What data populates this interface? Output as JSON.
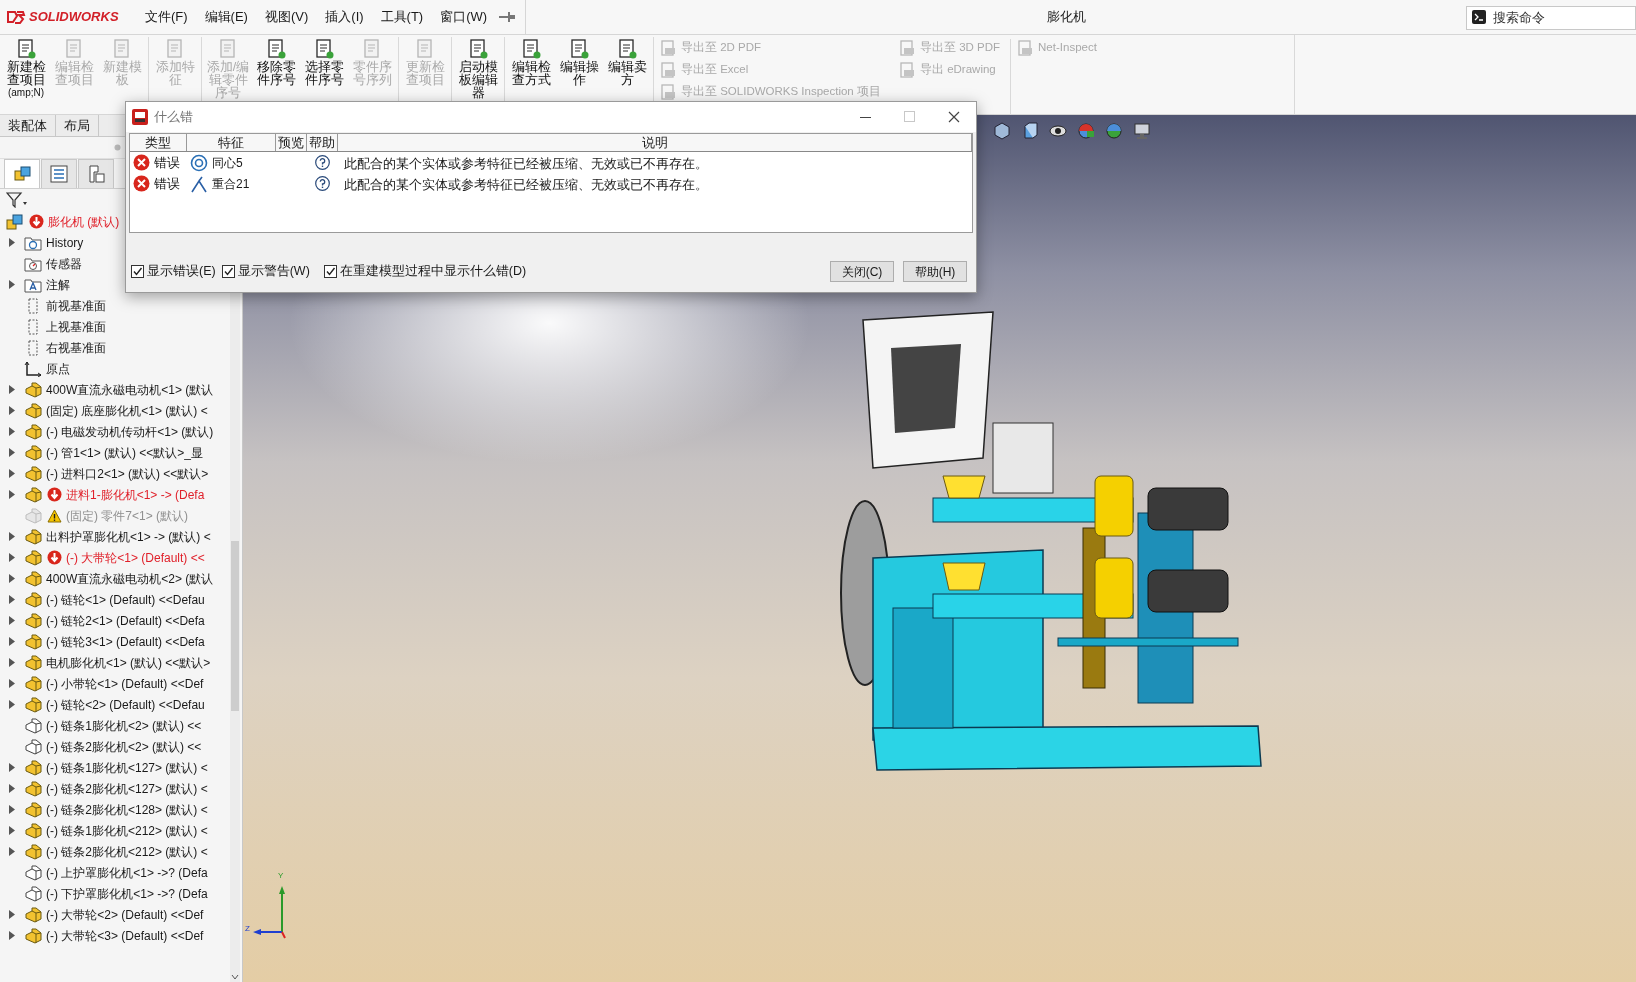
{
  "app": {
    "logo": "SOLIDWORKS",
    "menus": [
      "文件(F)",
      "编辑(E)",
      "视图(V)",
      "插入(I)",
      "工具(T)",
      "窗口(W)"
    ],
    "document_title": "膨化机",
    "search": {
      "placeholder": "搜索命令"
    }
  },
  "ribbon": {
    "buttons": [
      {
        "label": "新建检查项目",
        "shortcut": "(amp;N)",
        "enabled": true,
        "separator_before": false
      },
      {
        "label": "编辑检查项目",
        "enabled": false,
        "separator_before": false
      },
      {
        "label": "新建模板",
        "enabled": false,
        "separator_before": false
      },
      {
        "label": "添加特征",
        "enabled": false,
        "separator_before": true
      },
      {
        "label": "添加/编辑零件序号",
        "enabled": false,
        "separator_before": true
      },
      {
        "label": "移除零件序号",
        "enabled": true,
        "separator_before": false
      },
      {
        "label": "选择零件序号",
        "enabled": true,
        "separator_before": false
      },
      {
        "label": "零件序号序列",
        "enabled": false,
        "separator_before": false
      },
      {
        "label": "更新检查项目",
        "enabled": false,
        "separator_before": true
      },
      {
        "label": "启动模板编辑器",
        "enabled": true,
        "separator_before": true
      },
      {
        "label": "编辑检查方式",
        "enabled": true,
        "separator_before": true
      },
      {
        "label": "编辑操作",
        "enabled": true,
        "separator_before": false
      },
      {
        "label": "编辑卖方",
        "enabled": true,
        "separator_before": false
      }
    ],
    "export_columns": [
      [
        {
          "label": "导出至 2D PDF",
          "enabled": false
        },
        {
          "label": "导出至 Excel",
          "enabled": false
        },
        {
          "label": "导出至 SOLIDWORKS Inspection 项目",
          "enabled": false
        }
      ],
      [
        {
          "label": "导出至 3D PDF",
          "enabled": false
        },
        {
          "label": "导出 eDrawing",
          "enabled": false
        }
      ],
      [
        {
          "label": "Net-Inspect",
          "enabled": false
        }
      ]
    ]
  },
  "command_tabs": [
    {
      "label": "装配体"
    },
    {
      "label": "布局"
    }
  ],
  "panel_tabs": [
    {
      "kind": "tree",
      "selected": true
    },
    {
      "kind": "properties",
      "selected": false
    },
    {
      "kind": "configurations",
      "selected": false
    }
  ],
  "feature_tree": [
    {
      "label": "膨化机 (默认)",
      "kind": "assembly",
      "error": true,
      "warning": false,
      "suppressed": false,
      "expandable": false,
      "children": [
        {
          "label": "History",
          "kind": "history",
          "error": false,
          "warning": false,
          "suppressed": false,
          "expandable": true
        },
        {
          "label": "传感器",
          "kind": "sensors",
          "error": false,
          "warning": false,
          "suppressed": false,
          "expandable": false
        },
        {
          "label": "注解",
          "kind": "annotations",
          "error": false,
          "warning": false,
          "suppressed": false,
          "expandable": true
        },
        {
          "label": "前视基准面",
          "kind": "plane",
          "error": false,
          "warning": false,
          "suppressed": false,
          "expandable": false
        },
        {
          "label": "上视基准面",
          "kind": "plane",
          "error": false,
          "warning": false,
          "suppressed": false,
          "expandable": false
        },
        {
          "label": "右视基准面",
          "kind": "plane",
          "error": false,
          "warning": false,
          "suppressed": false,
          "expandable": false
        },
        {
          "label": "原点",
          "kind": "origin",
          "error": false,
          "warning": false,
          "suppressed": false,
          "expandable": false
        },
        {
          "label": "400W直流永磁电动机<1> (默认",
          "kind": "part",
          "error": false,
          "warning": false,
          "suppressed": false,
          "shown": true,
          "expandable": true
        },
        {
          "label": "(固定) 底座膨化机<1> (默认) <",
          "kind": "part",
          "error": false,
          "warning": false,
          "suppressed": false,
          "shown": true,
          "expandable": true
        },
        {
          "label": "(-) 电磁发动机传动杆<1> (默认)",
          "kind": "part",
          "error": false,
          "warning": false,
          "suppressed": false,
          "shown": true,
          "expandable": true
        },
        {
          "label": "(-) 管1<1> (默认) <<默认>_显",
          "kind": "part",
          "error": false,
          "warning": false,
          "suppressed": false,
          "shown": true,
          "expandable": true
        },
        {
          "label": "(-) 进料口2<1> (默认) <<默认>",
          "kind": "part",
          "error": false,
          "warning": false,
          "suppressed": false,
          "shown": true,
          "expandable": true
        },
        {
          "label": "进料1-膨化机<1> -> (Defa",
          "kind": "part",
          "error": true,
          "warning": false,
          "suppressed": false,
          "shown": true,
          "expandable": true
        },
        {
          "label": "(固定) 零件7<1> (默认)",
          "kind": "part",
          "error": false,
          "warning": true,
          "suppressed": true,
          "expandable": false
        },
        {
          "label": "出料护罩膨化机<1> -> (默认) <",
          "kind": "part",
          "error": false,
          "warning": false,
          "suppressed": false,
          "shown": true,
          "expandable": true
        },
        {
          "label": "(-) 大带轮<1> (Default) <<",
          "kind": "part",
          "error": true,
          "warning": false,
          "suppressed": false,
          "shown": true,
          "expandable": true
        },
        {
          "label": "400W直流永磁电动机<2> (默认",
          "kind": "part",
          "error": false,
          "warning": false,
          "suppressed": false,
          "shown": true,
          "expandable": true
        },
        {
          "label": "(-) 链轮<1> (Default) <<Defau",
          "kind": "part",
          "error": false,
          "warning": false,
          "suppressed": false,
          "shown": true,
          "expandable": true
        },
        {
          "label": "(-) 链轮2<1> (Default) <<Defa",
          "kind": "part",
          "error": false,
          "warning": false,
          "suppressed": false,
          "shown": true,
          "expandable": true
        },
        {
          "label": "(-) 链轮3<1> (Default) <<Defa",
          "kind": "part",
          "error": false,
          "warning": false,
          "suppressed": false,
          "shown": true,
          "expandable": true
        },
        {
          "label": "电机膨化机<1> (默认) <<默认>",
          "kind": "part",
          "error": false,
          "warning": false,
          "suppressed": false,
          "shown": true,
          "expandable": true
        },
        {
          "label": "(-) 小带轮<1> (Default) <<Def",
          "kind": "part",
          "error": false,
          "warning": false,
          "suppressed": false,
          "shown": true,
          "expandable": true
        },
        {
          "label": "(-) 链轮<2> (Default) <<Defau",
          "kind": "part",
          "error": false,
          "warning": false,
          "suppressed": false,
          "shown": true,
          "expandable": true
        },
        {
          "label": "(-) 链条1膨化机<2> (默认) <<",
          "kind": "part",
          "error": false,
          "warning": false,
          "suppressed": false,
          "shown": false,
          "expandable": false
        },
        {
          "label": "(-) 链条2膨化机<2> (默认) <<",
          "kind": "part",
          "error": false,
          "warning": false,
          "suppressed": false,
          "shown": false,
          "expandable": false
        },
        {
          "label": "(-) 链条1膨化机<127> (默认) <",
          "kind": "part",
          "error": false,
          "warning": false,
          "suppressed": false,
          "shown": true,
          "expandable": true
        },
        {
          "label": "(-) 链条2膨化机<127> (默认) <",
          "kind": "part",
          "error": false,
          "warning": false,
          "suppressed": false,
          "shown": true,
          "expandable": true
        },
        {
          "label": "(-) 链条2膨化机<128> (默认) <",
          "kind": "part",
          "error": false,
          "warning": false,
          "suppressed": false,
          "shown": true,
          "expandable": true
        },
        {
          "label": "(-) 链条1膨化机<212> (默认) <",
          "kind": "part",
          "error": false,
          "warning": false,
          "suppressed": false,
          "shown": true,
          "expandable": true
        },
        {
          "label": "(-) 链条2膨化机<212> (默认) <",
          "kind": "part",
          "error": false,
          "warning": false,
          "suppressed": false,
          "shown": true,
          "expandable": true
        },
        {
          "label": "(-) 上护罩膨化机<1> ->? (Defa",
          "kind": "part",
          "error": false,
          "warning": false,
          "suppressed": false,
          "shown": false,
          "expandable": false
        },
        {
          "label": "(-) 下护罩膨化机<1> ->? (Defa",
          "kind": "part",
          "error": false,
          "warning": false,
          "suppressed": false,
          "shown": false,
          "expandable": false
        },
        {
          "label": "(-) 大带轮<2> (Default) <<Def",
          "kind": "part",
          "error": false,
          "warning": false,
          "suppressed": false,
          "shown": true,
          "expandable": true
        },
        {
          "label": "(-) 大带轮<3> (Default) <<Def",
          "kind": "part",
          "error": false,
          "warning": false,
          "suppressed": false,
          "shown": true,
          "expandable": true
        }
      ]
    }
  ],
  "dialog": {
    "title": "什么错",
    "columns": [
      "类型",
      "特征",
      "预览",
      "帮助",
      "说明"
    ],
    "rows": [
      {
        "kind": "concentric",
        "error": true,
        "type": "错误",
        "feature": "同心5",
        "description": "此配合的某个实体或参考特征已经被压缩、无效或已不再存在。"
      },
      {
        "kind": "coincident",
        "error": true,
        "type": "错误",
        "feature": "重合21",
        "description": "此配合的某个实体或参考特征已经被压缩、无效或已不再存在。"
      }
    ],
    "checkboxes": [
      {
        "label": "显示错误(E)",
        "checked": true
      },
      {
        "label": "显示警告(W)",
        "checked": true
      },
      {
        "label": "在重建模型过程中显示什么错(D)",
        "checked": true
      }
    ],
    "buttons": [
      "关闭(C)",
      "帮助(H)"
    ]
  },
  "triad": {
    "labels": [
      "Y",
      "Z"
    ]
  }
}
